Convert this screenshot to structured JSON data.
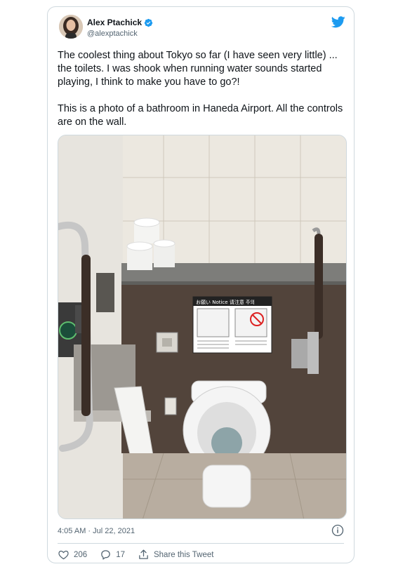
{
  "author": {
    "name": "Alex Ptachick",
    "handle": "@alexptachick",
    "verified": true
  },
  "tweet": {
    "paragraphs": [
      "The coolest thing about Tokyo so far (I have seen very little) ... the toilets. I was shook when running water sounds started playing, I think to make you have to go?!",
      "This is a photo of a bathroom in Haneda Airport. All the controls are on the wall."
    ],
    "timestamp": "4:05 AM · Jul 22, 2021"
  },
  "photo": {
    "notice_header": "お願い  Notice  请注意  주의"
  },
  "actions": {
    "likes": "206",
    "replies": "17",
    "share_label": "Share this Tweet"
  },
  "icons": {
    "verified": "verified-badge-icon",
    "brand": "twitter-bird-icon",
    "info": "info-icon",
    "like": "heart-icon",
    "reply": "reply-bubble-icon",
    "share": "share-icon"
  },
  "colors": {
    "brand": "#1d9bf0",
    "text": "#0f1419",
    "secondary": "#536471",
    "border": "#cfd9de"
  }
}
